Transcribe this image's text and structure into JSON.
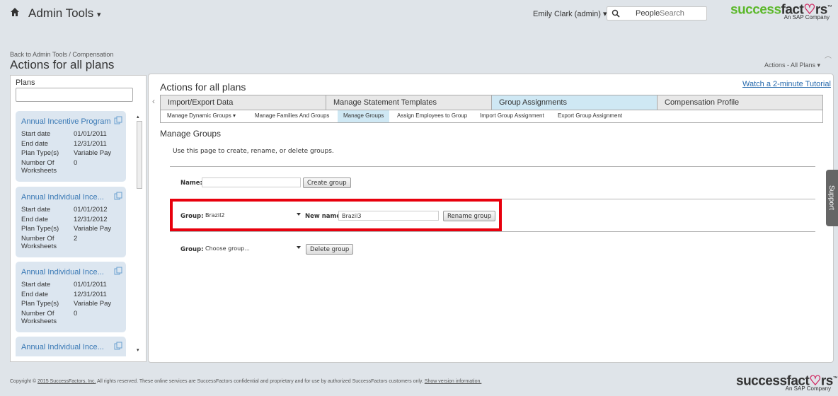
{
  "header": {
    "app_title": "Admin Tools",
    "user": "Emily Clark (admin)",
    "search_scope": "People",
    "search_placeholder": "Search",
    "logo_success": "success",
    "logo_fact": "fact",
    "logo_heart": "♡",
    "logo_rs": "rs",
    "logo_tm": "™",
    "logo_sub": "An SAP Company"
  },
  "breadcrumb": {
    "link": "Back to Admin Tools",
    "separator": " / ",
    "current": "Compensation"
  },
  "page_title": "Actions for all plans",
  "actions_menu": "Actions - All Plans",
  "plans": {
    "label": "Plans",
    "search_value": "",
    "cards": [
      {
        "title": "Annual Incentive Program",
        "start_label": "Start date",
        "start": "01/01/2011",
        "end_label": "End date",
        "end": "12/31/2011",
        "type_label": "Plan Type(s)",
        "type": "Variable Pay",
        "ws_label_1": "Number Of",
        "ws_label_2": "Worksheets",
        "ws": "0"
      },
      {
        "title": "Annual Individual Ince...",
        "start_label": "Start date",
        "start": "01/01/2012",
        "end_label": "End date",
        "end": "12/31/2012",
        "type_label": "Plan Type(s)",
        "type": "Variable Pay",
        "ws_label_1": "Number Of",
        "ws_label_2": "Worksheets",
        "ws": "2"
      },
      {
        "title": "Annual Individual Ince...",
        "start_label": "Start date",
        "start": "01/01/2011",
        "end_label": "End date",
        "end": "12/31/2011",
        "type_label": "Plan Type(s)",
        "type": "Variable Pay",
        "ws_label_1": "Number Of",
        "ws_label_2": "Worksheets",
        "ws": "0"
      },
      {
        "title": "Annual Individual Ince..."
      }
    ]
  },
  "main": {
    "title": "Actions for all plans",
    "tutorial_link": "Watch a 2-minute Tutorial",
    "tabs": [
      "Import/Export Data",
      "Manage Statement Templates",
      "Group Assignments",
      "Compensation Profile"
    ],
    "active_tab": "Group Assignments",
    "subtabs": [
      "Manage Dynamic Groups",
      "Manage Families And Groups",
      "Manage Groups",
      "Assign Employees to Group",
      "Import Group Assignment",
      "Export Group Assignment"
    ],
    "active_subtab": "Manage Groups",
    "section_title": "Manage Groups",
    "section_desc": "Use this page to create, rename, or delete groups.",
    "create": {
      "name_label": "Name:",
      "name_value": "",
      "button": "Create group"
    },
    "rename": {
      "group_label": "Group:",
      "group_value": "Brazil2",
      "new_name_label": "New name:",
      "new_name_value": "Brazil3",
      "button": "Rename group"
    },
    "delete": {
      "group_label": "Group:",
      "group_value": "Choose group...",
      "button": "Delete group"
    }
  },
  "support_tab": "Support",
  "footer": {
    "copyright_prefix": "Copyright © ",
    "copyright_link": "2015 SuccessFactors, Inc.",
    "copyright_text": " All rights reserved. These online services are SuccessFactors confidential and proprietary and for use by authorized SuccessFactors customers only. ",
    "version_link": "Show version information."
  },
  "colors": {
    "accent_tab": "#cfe8f4",
    "highlight": "#e8000d",
    "link": "#2569ad",
    "logo_green": "#5cb82b"
  }
}
